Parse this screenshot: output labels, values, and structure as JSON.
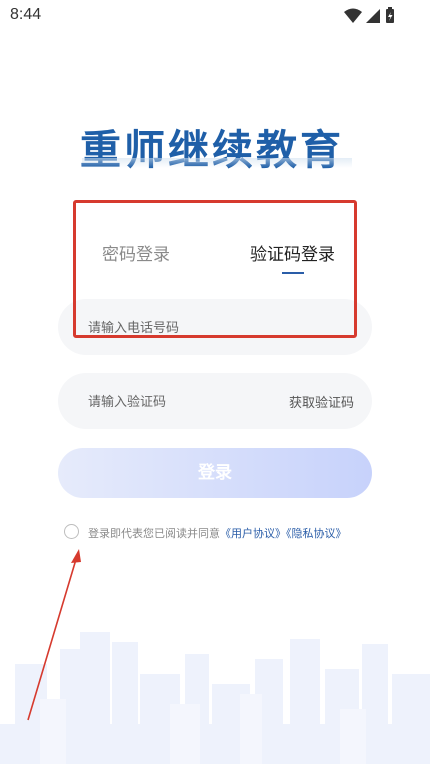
{
  "status_bar": {
    "time": "8:44"
  },
  "logo": {
    "text": "重师继续教育"
  },
  "tabs": [
    {
      "label": "密码登录",
      "active": false
    },
    {
      "label": "验证码登录",
      "active": true
    }
  ],
  "phone_field": {
    "placeholder": "请输入电话号码",
    "value": ""
  },
  "code_field": {
    "placeholder": "请输入验证码",
    "value": "",
    "action_label": "获取验证码"
  },
  "login_button": {
    "label": "登录"
  },
  "agreement": {
    "prefix": "登录即代表您已阅读并同意",
    "user_agreement": "《用户协议》",
    "privacy_agreement": "《隐私协议》",
    "checked": false
  },
  "colors": {
    "brand_blue": "#1f5fa8",
    "link_blue": "#2a5da8",
    "annotation_red": "#d63a2e",
    "button_gradient_start": "#e6ebfb",
    "button_gradient_end": "#c7d2fb"
  }
}
